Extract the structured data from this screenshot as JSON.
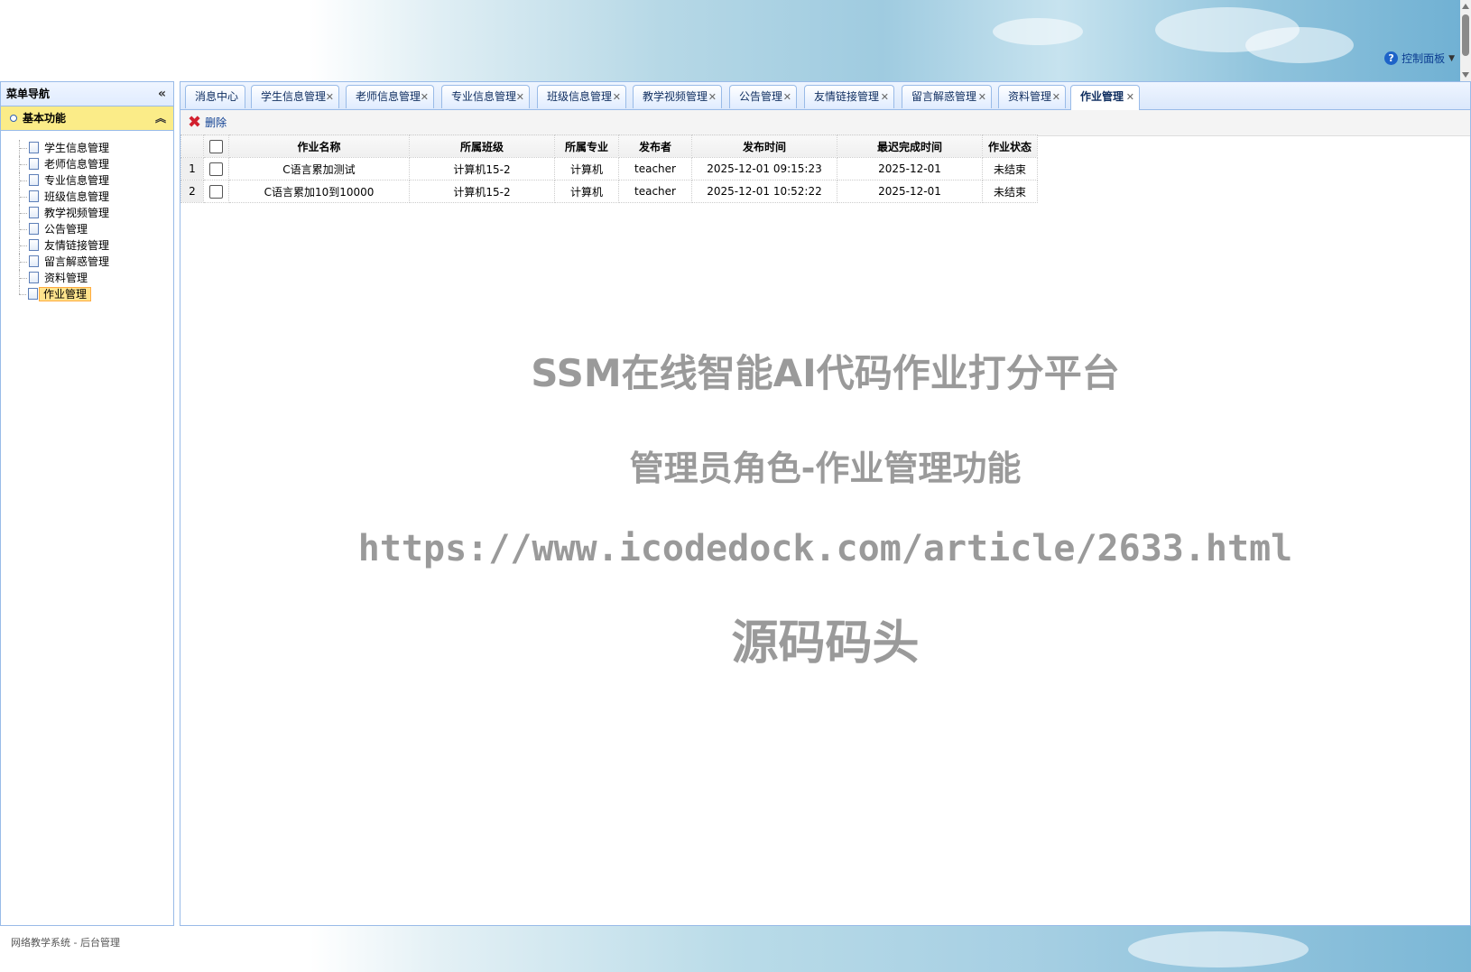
{
  "header": {
    "control_panel_label": "控制面板"
  },
  "sidebar": {
    "title": "菜单导航",
    "section": "基本功能",
    "items": [
      {
        "label": "学生信息管理"
      },
      {
        "label": "老师信息管理"
      },
      {
        "label": "专业信息管理"
      },
      {
        "label": "班级信息管理"
      },
      {
        "label": "教学视频管理"
      },
      {
        "label": "公告管理"
      },
      {
        "label": "友情链接管理"
      },
      {
        "label": "留言解惑管理"
      },
      {
        "label": "资料管理"
      },
      {
        "label": "作业管理"
      }
    ],
    "selected": "作业管理"
  },
  "tabs": [
    {
      "label": "消息中心"
    },
    {
      "label": "学生信息管理"
    },
    {
      "label": "老师信息管理"
    },
    {
      "label": "专业信息管理"
    },
    {
      "label": "班级信息管理"
    },
    {
      "label": "教学视频管理"
    },
    {
      "label": "公告管理"
    },
    {
      "label": "友情链接管理"
    },
    {
      "label": "留言解惑管理"
    },
    {
      "label": "资料管理"
    },
    {
      "label": "作业管理"
    }
  ],
  "active_tab": "作业管理",
  "toolbar": {
    "delete_label": "删除"
  },
  "table": {
    "columns": [
      "作业名称",
      "所属班级",
      "所属专业",
      "发布者",
      "发布时间",
      "最迟完成时间",
      "作业状态"
    ],
    "rows": [
      {
        "num": "1",
        "name": "C语言累加测试",
        "class": "计算机15-2",
        "major": "计算机",
        "publisher": "teacher",
        "publish_time": "2025-12-01 09:15:23",
        "deadline": "2025-12-01",
        "status": "未结束"
      },
      {
        "num": "2",
        "name": "C语言累加10到10000",
        "class": "计算机15-2",
        "major": "计算机",
        "publisher": "teacher",
        "publish_time": "2025-12-01 10:52:22",
        "deadline": "2025-12-01",
        "status": "未结束"
      }
    ]
  },
  "watermark": {
    "line1": "SSM在线智能AI代码作业打分平台",
    "line2": "管理员角色-作业管理功能",
    "line3": "https://www.icodedock.com/article/2633.html",
    "line4": "源码码头"
  },
  "footer": {
    "text": "网络教学系统 - 后台管理"
  },
  "colors": {
    "accent": "#99bbe8",
    "highlight": "#fbec88",
    "delete": "#d2202e"
  }
}
